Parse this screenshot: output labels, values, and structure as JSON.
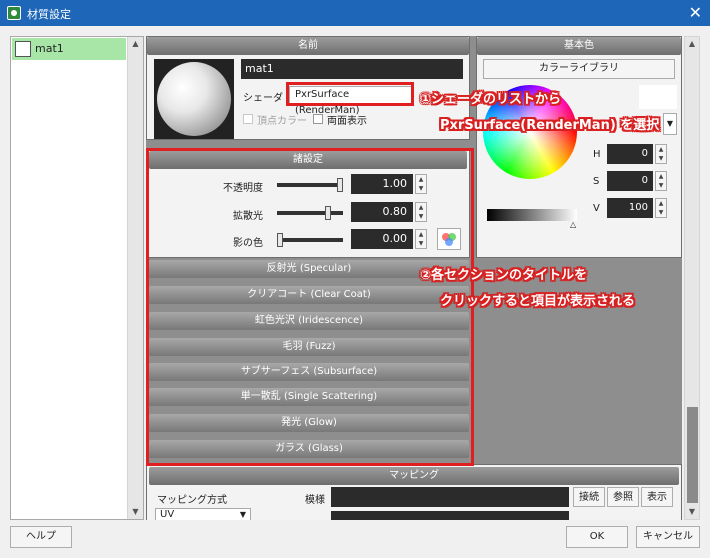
{
  "window": {
    "title": "材質設定"
  },
  "material_list": {
    "items": [
      {
        "label": "mat1"
      }
    ]
  },
  "name_section": {
    "header": "名前",
    "name_value": "mat1",
    "shader_label": "シェーダ",
    "shader_value": "PxrSurface (RenderMan)",
    "vertex_color_label": "頂点カラー",
    "double_sided_label": "両面表示"
  },
  "settings_section": {
    "header": "諸設定",
    "rows": [
      {
        "label": "不透明度",
        "value": "1.00",
        "level": 1.0
      },
      {
        "label": "拡散光",
        "value": "0.80",
        "level": 0.8
      },
      {
        "label": "影の色",
        "value": "0.00",
        "level": 0.0
      }
    ]
  },
  "collapsed_sections": [
    "反射光 (Specular)",
    "クリアコート (Clear Coat)",
    "虹色光沢 (Iridescence)",
    "毛羽 (Fuzz)",
    "サブサーフェス (Subsurface)",
    "単一散乱 (Single Scattering)",
    "発光 (Glow)",
    "ガラス (Glass)"
  ],
  "mapping_section": {
    "header": "マッピング",
    "method_label": "マッピング方式",
    "method_value": "UV",
    "pattern_label": "模様",
    "buttons": [
      "接続",
      "参照",
      "表示"
    ]
  },
  "base_color": {
    "header": "基本色",
    "library_button": "カラーライブラリ",
    "h_label": "H",
    "h_value": "0",
    "s_label": "S",
    "s_value": "0",
    "v_label": "V",
    "v_value": "100"
  },
  "annotations": {
    "note1_line1": "①シェーダのリストから",
    "note1_line2": "PxrSurface(RenderMan) を選択",
    "note2_line1": "②各セクションのタイトルを",
    "note2_line2": "クリックすると項目が表示される"
  },
  "footer": {
    "help": "ヘルプ",
    "ok": "OK",
    "cancel": "キャンセル"
  },
  "colors": {
    "titlebar": "#1e66b8",
    "highlight": "#e02020",
    "list_selected": "#a8e6a8"
  }
}
